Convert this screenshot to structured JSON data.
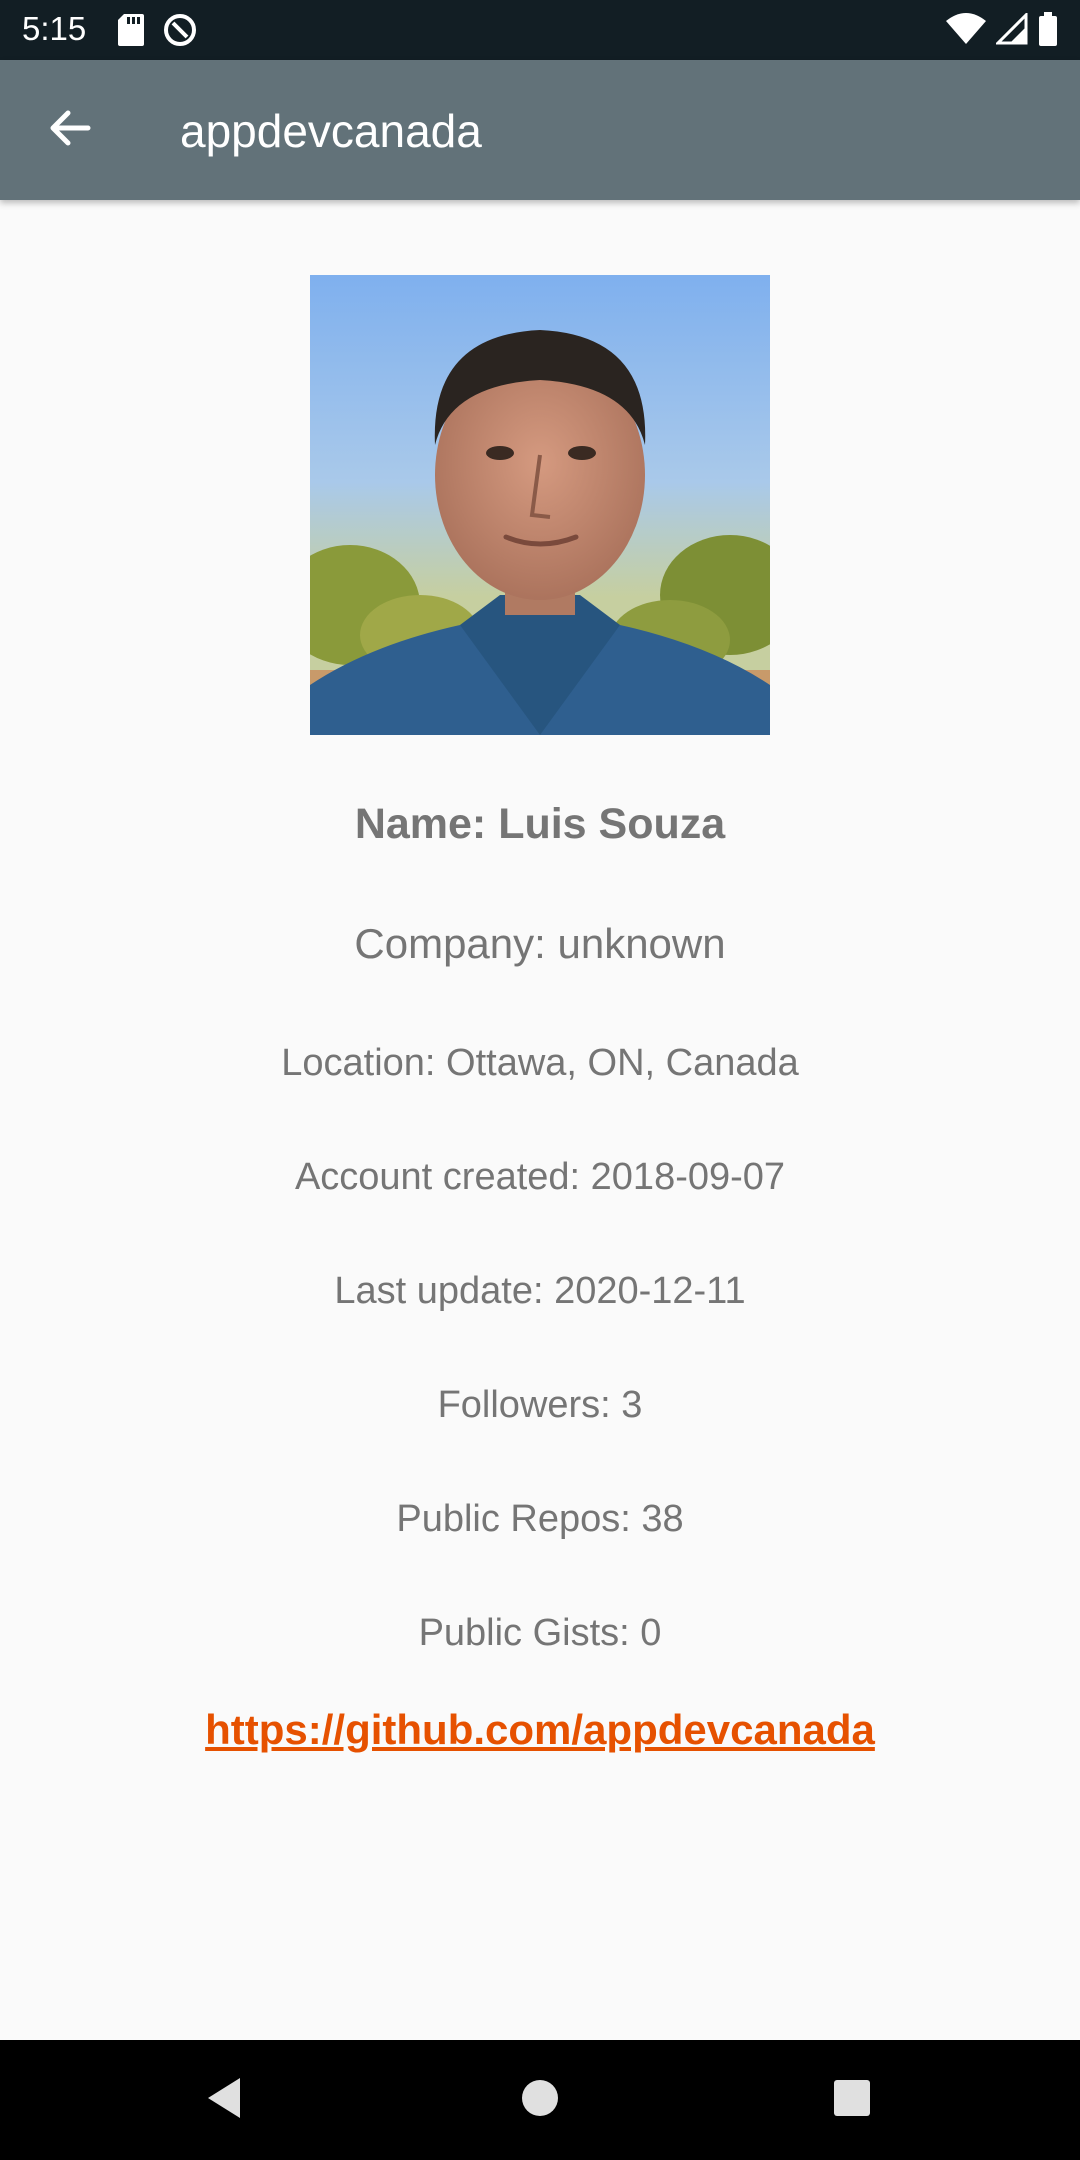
{
  "status_bar": {
    "time": "5:15",
    "icons": [
      "sd-card-icon",
      "data-saver-icon",
      "wifi-icon",
      "signal-icon",
      "battery-icon"
    ]
  },
  "app_bar": {
    "title": "appdevcanada",
    "back_icon": "arrow-left-icon"
  },
  "profile": {
    "name": "Name: Luis Souza",
    "company": "Company: unknown",
    "location": "Location: Ottawa, ON, Canada",
    "account_created": "Account created: 2018-09-07",
    "last_update": "Last update: 2020-12-11",
    "followers": "Followers: 3",
    "public_repos": "Public Repos: 38",
    "public_gists": "Public Gists: 0",
    "url": "https://github.com/appdevcanada"
  },
  "nav_bar": {
    "buttons": [
      "back-triangle-icon",
      "home-circle-icon",
      "recents-square-icon"
    ]
  },
  "colors": {
    "status_bar": "#121e24",
    "app_bar": "#627279",
    "background": "#fafafa",
    "text": "#757575",
    "link": "#e65100"
  }
}
